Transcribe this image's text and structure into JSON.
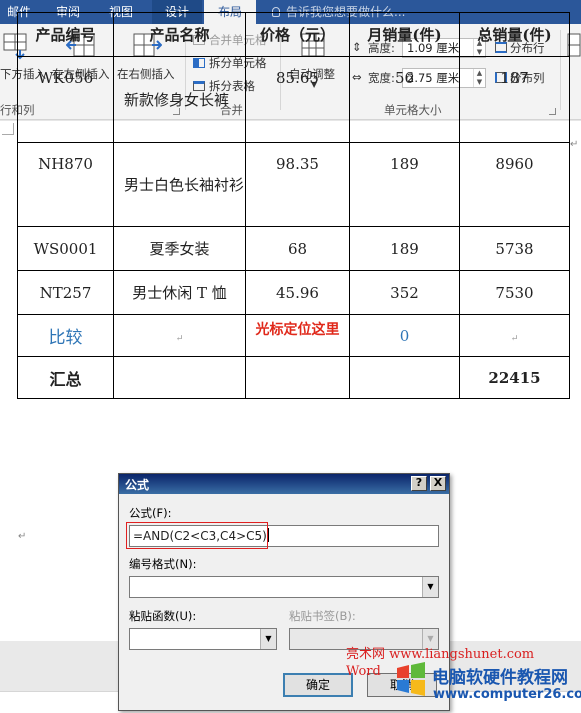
{
  "tabs": [
    {
      "label": "邮件"
    },
    {
      "label": "审阅"
    },
    {
      "label": "视图"
    },
    {
      "label": "设计"
    },
    {
      "label": "布局"
    }
  ],
  "tell_me": "告诉我您想要做什么...",
  "ribbon": {
    "insert_below": "下方插入",
    "insert_left": "在左侧插入",
    "insert_right": "在右侧插入",
    "rows_cols_group": "行和列",
    "merge_cells": "合并单元格",
    "split_cells": "拆分单元格",
    "split_table": "拆分表格",
    "merge_group": "合并",
    "autofit": "自动调整",
    "height_label": "高度:",
    "height_value": "1.09 厘米",
    "width_label": "宽度:",
    "width_value": "2.75 厘米",
    "distribute_rows": "分布行",
    "distribute_cols": "分布列",
    "cell_size_group": "单元格大小"
  },
  "table": {
    "headers": [
      "产品编号",
      "产品名称",
      "价格（元）",
      "月销量(件)",
      "总销量(件)"
    ],
    "rows": [
      [
        "WK056",
        "新款修身女长裤",
        "85.65",
        "56",
        "187"
      ],
      [
        "NH870",
        "男士白色长袖衬衫",
        "98.35",
        "189",
        "8960"
      ],
      [
        "WS0001",
        "夏季女装",
        "68",
        "189",
        "5738"
      ],
      [
        "NT257",
        "男士休闲 T 恤",
        "45.96",
        "352",
        "7530"
      ]
    ],
    "compare_label": "比较",
    "cursor_note": "光标定位这里",
    "compare_result": "0",
    "total_label": "汇总",
    "total_value": "22415"
  },
  "dialog": {
    "title": "公式",
    "help": "?",
    "close": "X",
    "formula_label": "公式(F):",
    "formula_value": "=AND(C2<C3,C4>C5)",
    "number_format_label": "编号格式(N):",
    "paste_function_label": "粘贴函数(U):",
    "paste_bookmark_label": "粘贴书签(B):",
    "ok": "确定",
    "cancel": "取消"
  },
  "watermark": {
    "site1": "亮术网 www.liangshunet.com",
    "site2": "Word",
    "brand": "电脑软硬件教程网",
    "brand_url": "www.computer26.com"
  }
}
